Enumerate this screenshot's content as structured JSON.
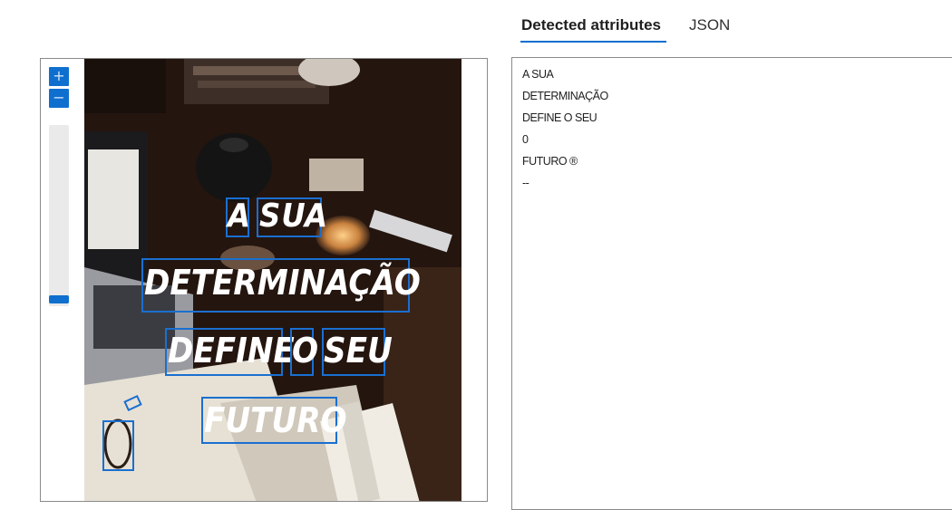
{
  "tabs": {
    "detected_label": "Detected attributes",
    "json_label": "JSON"
  },
  "zoom": {
    "in_label": "+",
    "out_label": "−"
  },
  "image": {
    "words": [
      {
        "text": "A"
      },
      {
        "text": "SUA"
      },
      {
        "text": "DETERMINAÇÃO"
      },
      {
        "text": "DEFINE"
      },
      {
        "text": "O"
      },
      {
        "text": "SEU"
      },
      {
        "text": "FUTURO"
      },
      {
        "text": "0"
      },
      {
        "text": "®"
      }
    ]
  },
  "detected_lines": [
    "A SUA",
    "DETERMINAÇÃO",
    "DEFINE O SEU",
    "0",
    "FUTURO ®",
    "--"
  ]
}
